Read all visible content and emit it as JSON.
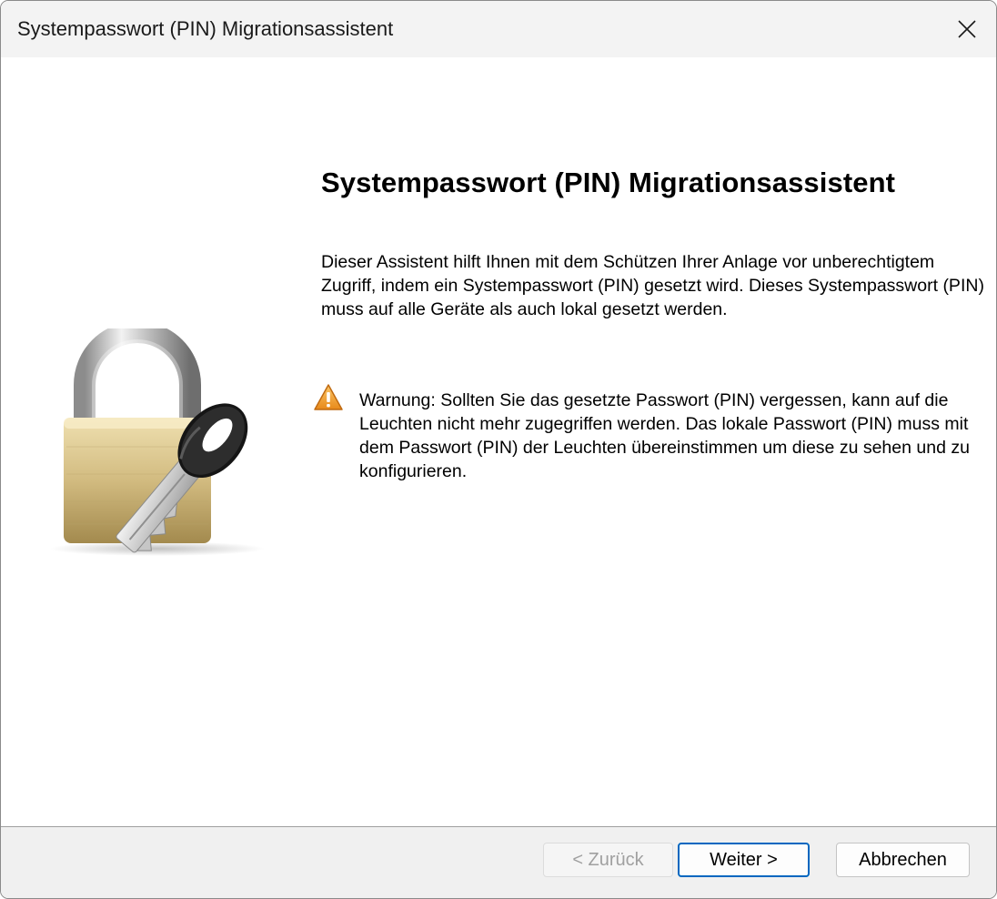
{
  "window": {
    "title": "Systempasswort (PIN) Migrationsassistent",
    "close_icon": "close-icon"
  },
  "main": {
    "heading": "Systempasswort (PIN) Migrationsassistent",
    "intro": "Dieser Assistent hilft Ihnen mit dem Schützen Ihrer Anlage vor unberechtigtem Zugriff, indem ein Systempasswort (PIN) gesetzt wird. Dieses Systempasswort (PIN) muss auf alle Geräte als auch lokal gesetzt werden.",
    "warning_icon": "warning-icon",
    "warning": "Warnung: Sollten Sie das gesetzte Passwort (PIN) vergessen, kann auf die Leuchten nicht mehr zugegriffen werden. Das lokale Passwort (PIN) muss mit dem Passwort (PIN) der Leuchten übereinstimmen um diese zu sehen und zu konfigurieren.",
    "illustration_icon": "padlock-with-key-icon"
  },
  "footer": {
    "back_label": "< Zurück",
    "next_label": "Weiter >",
    "cancel_label": "Abbrechen"
  },
  "colors": {
    "accent": "#0067c0",
    "warning": "#f0a030",
    "titlebar": "#f3f3f3",
    "footer": "#f0f0f0"
  }
}
